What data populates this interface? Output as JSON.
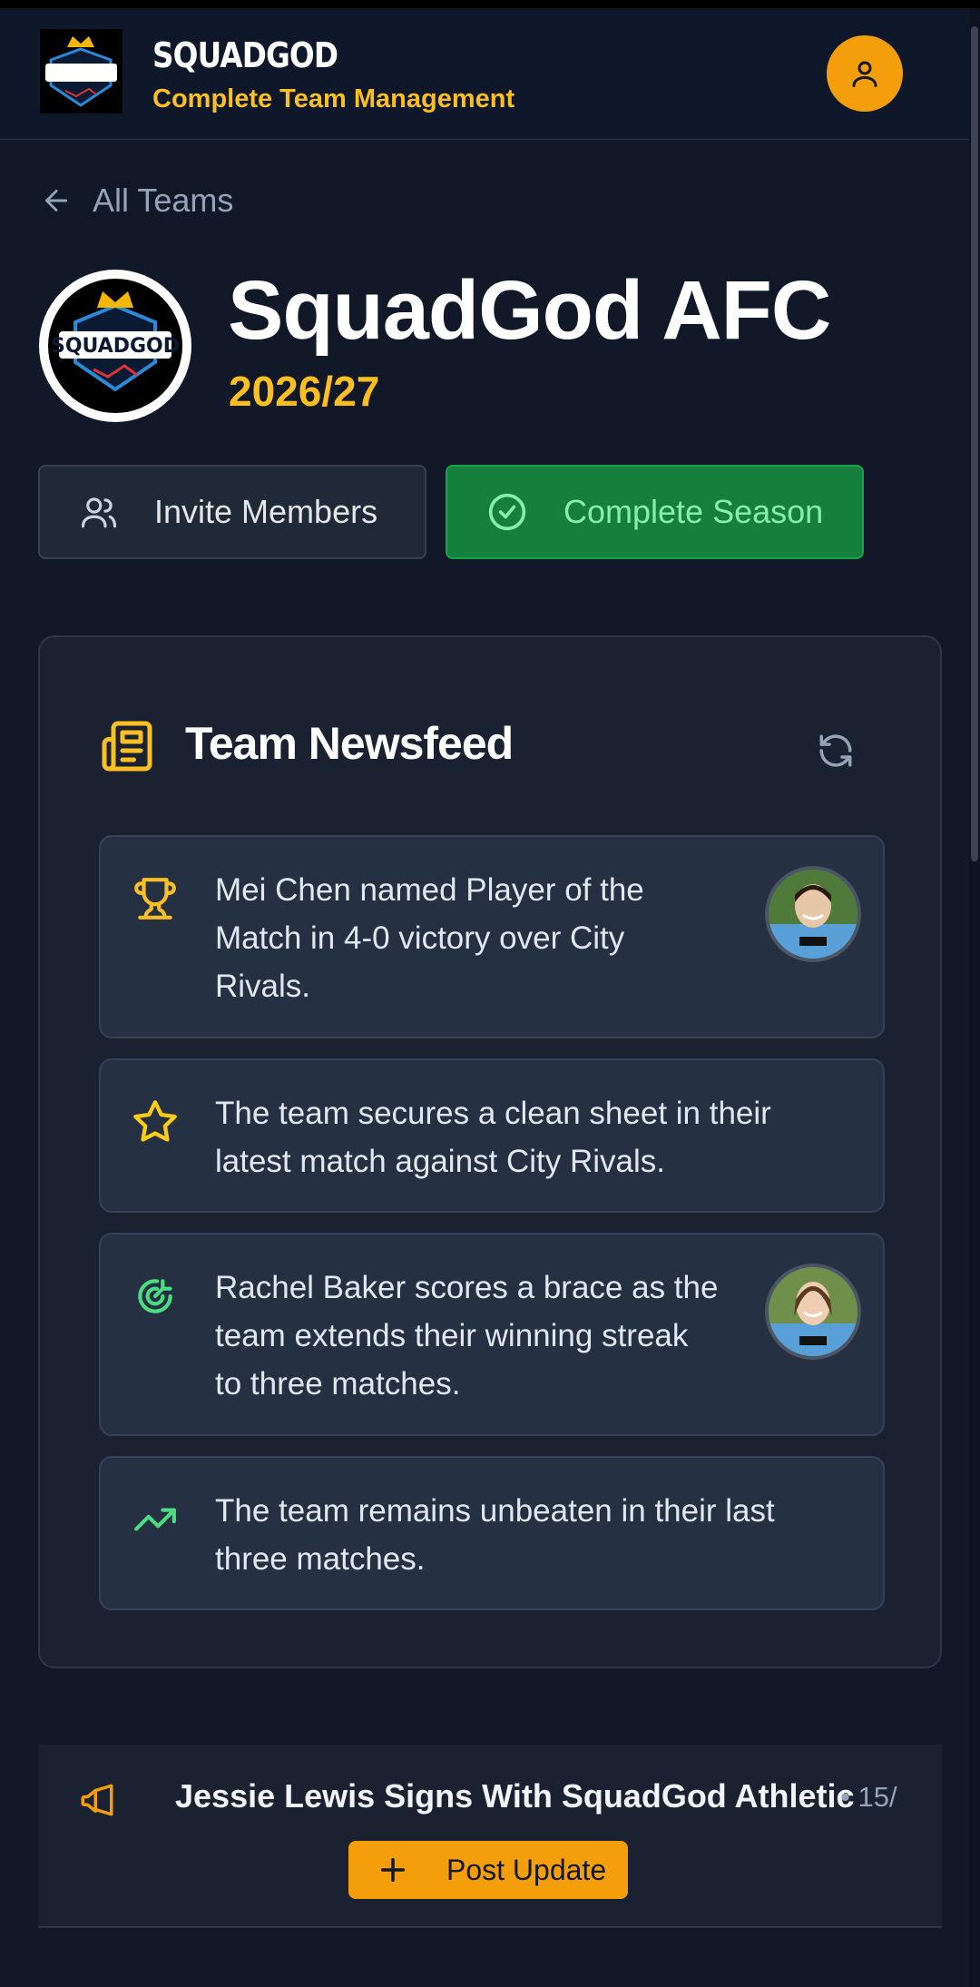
{
  "header": {
    "brand_name": "SQUADGOD",
    "tagline": "Complete Team Management",
    "logo_icon": "squadgod-crest-icon",
    "user_icon": "user-icon"
  },
  "nav": {
    "back_label": "All Teams",
    "back_icon": "arrow-left-icon"
  },
  "team": {
    "name": "SquadGod AFC",
    "season": "2026/27",
    "logo_text": "SQUADGOD"
  },
  "actions": {
    "invite_label": "Invite Members",
    "invite_icon": "users-icon",
    "complete_label": "Complete Season",
    "complete_icon": "check-circle-icon"
  },
  "newsfeed": {
    "title": "Team Newsfeed",
    "title_icon": "newspaper-icon",
    "refresh_icon": "refresh-icon",
    "items": [
      {
        "icon": "trophy-icon",
        "text": "Mei Chen named Player of the Match in 4-0 victory over City Rivals.",
        "has_avatar": true
      },
      {
        "icon": "star-icon",
        "text": "The team secures a clean sheet in their latest match against City Rivals.",
        "has_avatar": false
      },
      {
        "icon": "goal-target-icon",
        "text": "Rachel Baker scores a brace as the team extends their winning streak to three matches.",
        "has_avatar": true
      },
      {
        "icon": "trending-up-icon",
        "text": "The team remains unbeaten in their last three matches.",
        "has_avatar": false
      }
    ]
  },
  "announcement": {
    "icon": "megaphone-icon",
    "text": "Jessie Lewis Signs With SquadGod Athletic",
    "meta": "• 15/",
    "post_label": "Post Update",
    "post_icon": "plus-icon"
  },
  "colors": {
    "background": "#111827",
    "accent": "#f59e0b",
    "accent_text": "#fbbf24",
    "success": "#15803d",
    "card": "#1a2232",
    "item": "#263043"
  }
}
